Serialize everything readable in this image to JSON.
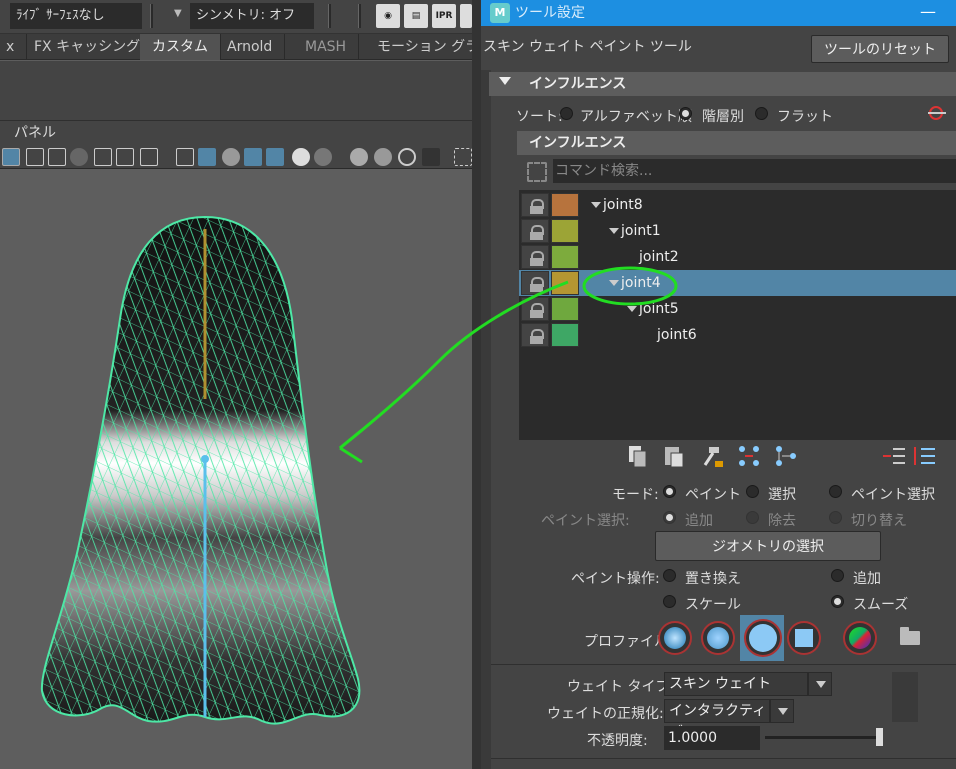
{
  "top_toolbar": {
    "live_surface": "ﾗｲﾌﾞ ｻｰﾌｪｽなし",
    "symmetry": "シンメトリ: オフ",
    "ipr_label": "IPR"
  },
  "shelf_tabs": [
    {
      "label": "x"
    },
    {
      "label": "FX キャッシング"
    },
    {
      "label": "カスタム"
    },
    {
      "label": "Arnold"
    },
    {
      "label": "MASH"
    },
    {
      "label": "モーション グラフィ"
    }
  ],
  "panel_menu": "パネル",
  "tool_settings": {
    "window_title": "ツール設定",
    "tool_name": "スキン ウェイト ペイント ツール",
    "reset_button": "ツールのリセット",
    "influence_section": "インフルエンス",
    "sort_label": "ソート:",
    "sort_options": [
      "アルファベット順",
      "階層別",
      "フラット"
    ],
    "sort_selected": "階層別",
    "influence_sub_header": "インフルエンス",
    "search_placeholder": "コマンド検索...",
    "influences": [
      {
        "name": "joint8",
        "color": "#b7733d",
        "has_children": true
      },
      {
        "name": "joint1",
        "color": "#9ca436",
        "has_children": true
      },
      {
        "name": "joint2",
        "color": "#7dab3d",
        "has_children": false
      },
      {
        "name": "joint4",
        "color": "#b59632",
        "has_children": true,
        "selected": true
      },
      {
        "name": "joint5",
        "color": "#6fa83e",
        "has_children": true
      },
      {
        "name": "joint6",
        "color": "#3ea765",
        "has_children": false
      }
    ],
    "mode_label": "モード:",
    "mode_options": [
      "ペイント",
      "選択",
      "ペイント選択"
    ],
    "paint_select_label": "ペイント選択:",
    "paint_select_options": [
      "追加",
      "除去",
      "切り替え"
    ],
    "geometry_select_button": "ジオメトリの選択",
    "paint_operation_label": "ペイント操作:",
    "paint_operation_options": [
      "置き換え",
      "追加",
      "スケール",
      "スムーズ"
    ],
    "paint_operation_selected": "スムーズ",
    "profile_label": "プロファイル:",
    "weight_type_label": "ウェイト タイプ:",
    "weight_type_value": "スキン ウェイト",
    "normalize_label": "ウェイトの正規化:",
    "normalize_value": "インタラクティブ",
    "opacity_label": "不透明度:",
    "opacity_value": "1.0000",
    "opacity_level": 1.0
  },
  "colors": {
    "title_bar": "#1d8fe1",
    "selection": "#5285a6",
    "wireframe": "#4de8a6",
    "annotation": "#22dd22"
  }
}
